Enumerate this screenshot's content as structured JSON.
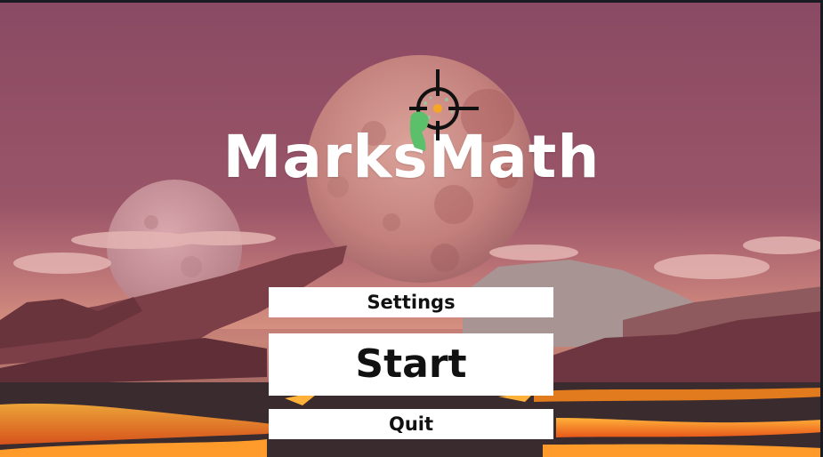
{
  "game": {
    "title": "MarksMath"
  },
  "menu": {
    "settings_label": "Settings",
    "start_label": "Start",
    "quit_label": "Quit"
  },
  "icons": {
    "logo": "crosshair-with-green-hand-icon"
  },
  "colors": {
    "sky": "#8a4a63",
    "moon": "#c98a86",
    "lava": "#ff8a1a",
    "button_bg": "#ffffff",
    "button_text": "#111111",
    "title_text": "#ffffff"
  }
}
